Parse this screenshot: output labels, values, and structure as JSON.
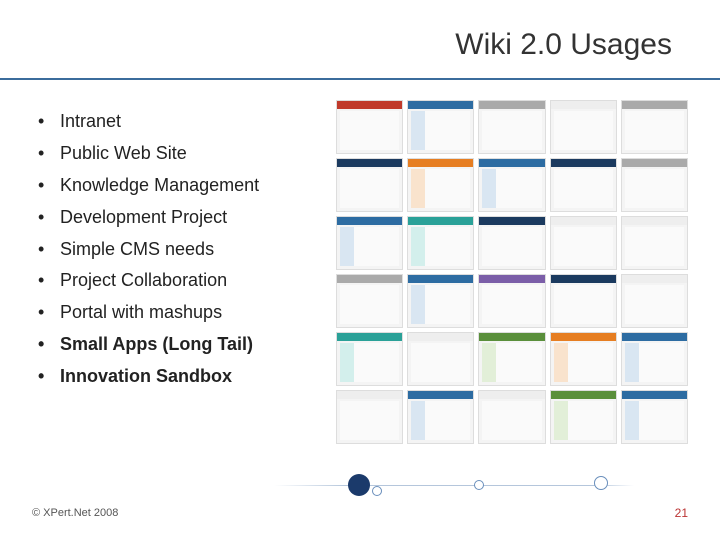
{
  "title": "Wiki 2.0 Usages",
  "bullets": [
    {
      "text": "Intranet",
      "bold": false
    },
    {
      "text": "Public Web Site",
      "bold": false
    },
    {
      "text": "Knowledge Management",
      "bold": false
    },
    {
      "text": "Development Project",
      "bold": false
    },
    {
      "text": "Simple CMS needs",
      "bold": false
    },
    {
      "text": "Project Collaboration",
      "bold": false
    },
    {
      "text": "Portal with mashups",
      "bold": false
    },
    {
      "text": "Small Apps (Long Tail)",
      "bold": true
    },
    {
      "text": "Innovation Sandbox",
      "bold": true
    }
  ],
  "thumbs": [
    "t-red",
    "t-blue",
    "t-gray",
    "t-white",
    "t-gray",
    "t-navy",
    "t-orange",
    "t-blue",
    "t-navy",
    "t-gray",
    "t-blue",
    "t-teal",
    "t-navy",
    "t-white",
    "t-white",
    "t-gray",
    "t-blue",
    "t-purple",
    "t-navy",
    "t-white",
    "t-teal",
    "t-white",
    "t-green",
    "t-orange",
    "t-blue",
    "t-white",
    "t-blue",
    "t-white",
    "t-green",
    "t-blue"
  ],
  "footer": {
    "copyright": "© XPert.Net 2008",
    "page": "21"
  }
}
